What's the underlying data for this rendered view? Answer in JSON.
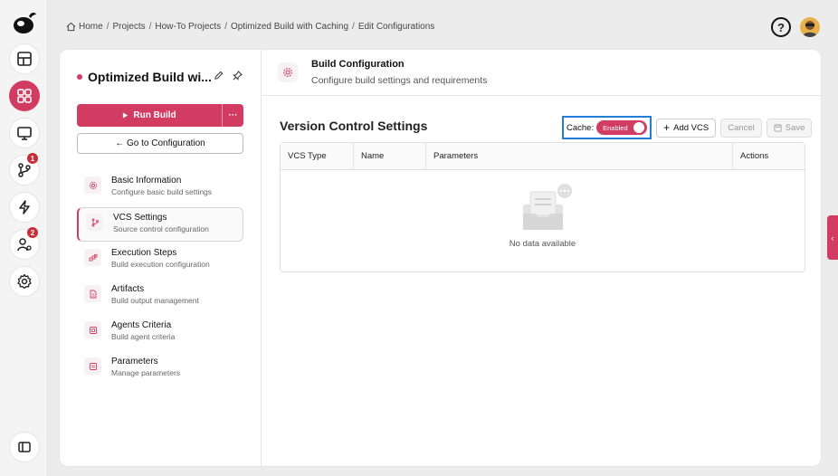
{
  "breadcrumb": {
    "items": [
      "Home",
      "Projects",
      "How-To Projects",
      "Optimized Build with Caching",
      "Edit Configurations"
    ],
    "separator": "/"
  },
  "rail": {
    "badges": {
      "vcs": "1",
      "users": "2"
    }
  },
  "build": {
    "title": "Optimized Build wi...",
    "run_label": "Run Build",
    "more_label": "···",
    "goto_label": "← Go to Configuration"
  },
  "nav": {
    "items": [
      {
        "title": "Basic Information",
        "subtitle": "Configure basic build settings",
        "icon": "gear-icon"
      },
      {
        "title": "VCS Settings",
        "subtitle": "Source control configuration",
        "icon": "branch-icon"
      },
      {
        "title": "Execution Steps",
        "subtitle": "Build execution configuration",
        "icon": "steps-icon"
      },
      {
        "title": "Artifacts",
        "subtitle": "Build output management",
        "icon": "file-icon"
      },
      {
        "title": "Agents Criteria",
        "subtitle": "Build agent criteria",
        "icon": "agent-icon"
      },
      {
        "title": "Parameters",
        "subtitle": "Manage parameters",
        "icon": "params-icon"
      }
    ],
    "active_index": 1
  },
  "header": {
    "title": "Build Configuration",
    "subtitle": "Configure build settings and requirements"
  },
  "vcs": {
    "title": "Version Control Settings",
    "cache_label": "Cache:",
    "cache_state": "Enabled",
    "add_label": "Add VCS",
    "cancel_label": "Cancel",
    "save_label": "Save"
  },
  "table": {
    "columns": [
      "VCS Type",
      "Name",
      "Parameters",
      "Actions"
    ],
    "empty_text": "No data available"
  },
  "side_tab": {
    "label": "‹"
  },
  "colors": {
    "accent": "#d23b62",
    "highlight": "#1f7fdb"
  }
}
